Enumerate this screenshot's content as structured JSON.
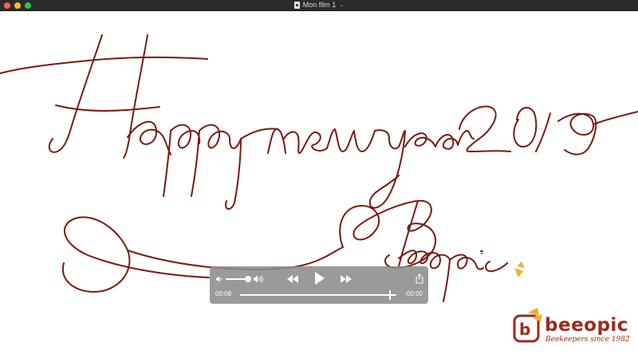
{
  "window": {
    "title": "Mon film 1"
  },
  "artwork": {
    "ink_color": "#7a1a10",
    "accent_color": "#e8b232"
  },
  "logo": {
    "name": "beeopic",
    "tagline": "Beekeepers since 1982",
    "color": "#9b2a1a"
  },
  "player": {
    "current_time": "00:08",
    "remaining_time": "-00:00",
    "progress": 0.96,
    "volume": 1.0
  }
}
